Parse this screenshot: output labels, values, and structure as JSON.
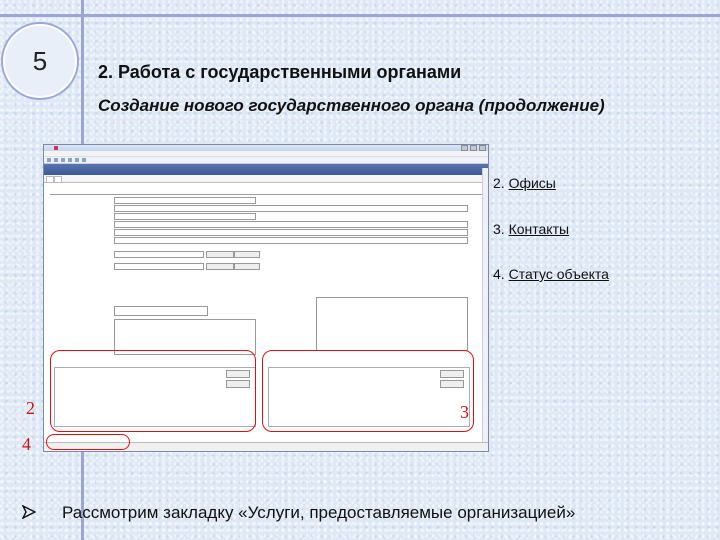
{
  "slide": {
    "number": "5",
    "title": "2. Работа с государственными органами",
    "subtitle": "Создание нового государственного органа (продолжение)",
    "bottom_text": "Рассмотрим закладку «Услуги, предоставляемые организацией»",
    "bullet_icon": "arrow-bullet-icon"
  },
  "callouts": [
    {
      "prefix": "2. ",
      "label": "Офисы"
    },
    {
      "prefix": "3. ",
      "label": "Контакты"
    },
    {
      "prefix": "4. ",
      "label": "Статус объекта"
    }
  ],
  "markers": {
    "two": "2",
    "three": "3",
    "four": "4"
  },
  "colors": {
    "accent_line": "#9aa6d8",
    "highlight": "#e01010",
    "header": "#3d5a98"
  }
}
